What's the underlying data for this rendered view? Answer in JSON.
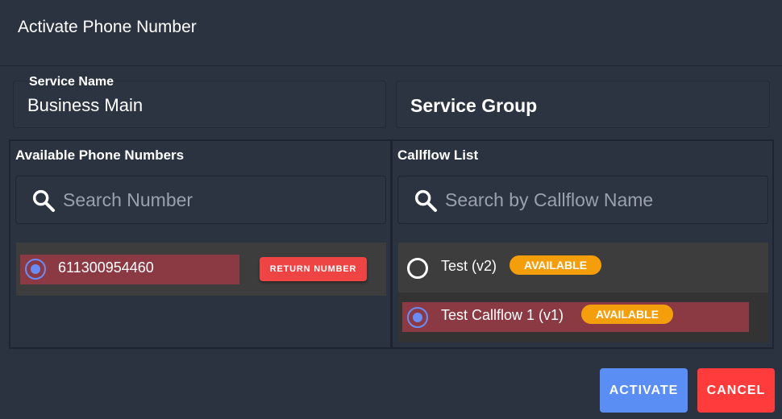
{
  "dialog": {
    "title": "Activate Phone Number"
  },
  "service_name": {
    "label": "Service Name",
    "value": "Business Main"
  },
  "service_group": {
    "placeholder": "Service Group"
  },
  "numbers_panel": {
    "title": "Available Phone Numbers",
    "search_placeholder": "Search Number",
    "items": [
      {
        "number": "611300954460",
        "selected": true,
        "action_label": "RETURN NUMBER"
      }
    ]
  },
  "callflow_panel": {
    "title": "Callflow List",
    "search_placeholder": "Search by Callflow Name",
    "items": [
      {
        "name": "Test (v2)",
        "status": "AVAILABLE",
        "selected": false
      },
      {
        "name": "Test Callflow 1 (v1)",
        "status": "AVAILABLE",
        "selected": true
      }
    ]
  },
  "actions": {
    "activate_label": "ACTIVATE",
    "cancel_label": "CANCEL"
  },
  "colors": {
    "background": "#2b3240",
    "selected_row": "#8b3a44",
    "radio_selected": "#6b8cf5",
    "badge_available": "#f59e0b",
    "activate_button": "#5b8ef5",
    "cancel_button": "#ff3b3b",
    "return_button": "#ef4444"
  }
}
